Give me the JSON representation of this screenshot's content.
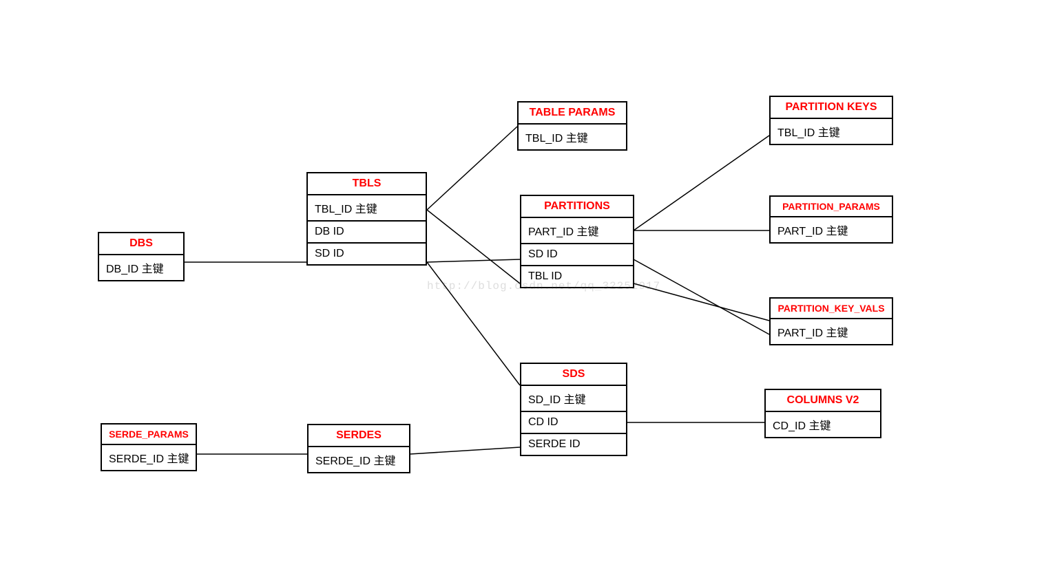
{
  "watermark": "http://blog.csdn.net/qq_32252917",
  "entities": {
    "dbs": {
      "title": "DBS",
      "rows": [
        "DB_ID   主键"
      ]
    },
    "tbls": {
      "title": "TBLS",
      "rows": [
        "TBL_ID   主键",
        "DB ID",
        "SD ID"
      ]
    },
    "table_params": {
      "title": "TABLE PARAMS",
      "rows": [
        "TBL_ID   主键"
      ]
    },
    "partitions": {
      "title": "PARTITIONS",
      "rows": [
        "PART_ID 主键",
        "SD ID",
        "TBL ID"
      ]
    },
    "partition_keys": {
      "title": "PARTITION KEYS",
      "rows": [
        "TBL_ID   主键"
      ]
    },
    "partition_params": {
      "title": "PARTITION_PARAMS",
      "rows": [
        "PART_ID   主键"
      ]
    },
    "partition_key_vals": {
      "title": "PARTITION_KEY_VALS",
      "rows": [
        "PART_ID   主键"
      ]
    },
    "sds": {
      "title": "SDS",
      "rows": [
        "SD_ID 主键",
        "CD ID",
        "SERDE ID"
      ]
    },
    "columns_v2": {
      "title": "COLUMNS V2",
      "rows": [
        "CD_ID 主键"
      ]
    },
    "serdes": {
      "title": "SERDES",
      "rows": [
        "SERDE_ID 主键"
      ]
    },
    "serde_params": {
      "title": "SERDE_PARAMS",
      "rows": [
        "SERDE_ID 主键"
      ]
    }
  }
}
